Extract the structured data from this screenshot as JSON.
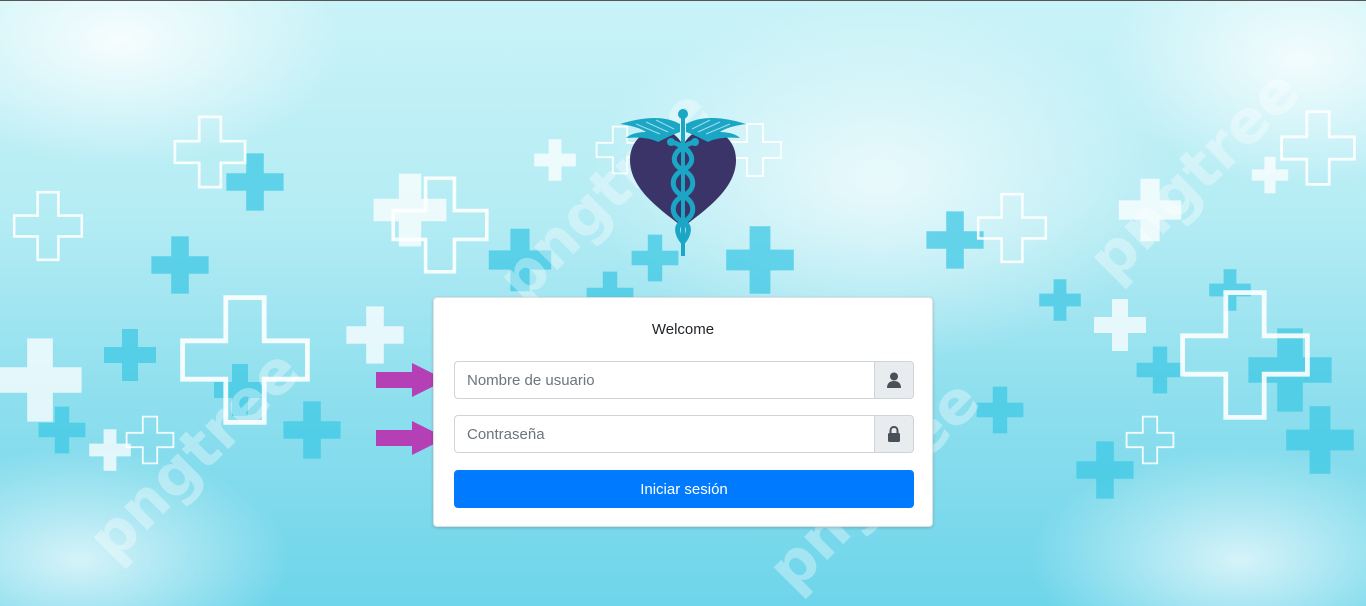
{
  "login": {
    "title": "Welcome",
    "username": {
      "placeholder": "Nombre de usuario",
      "value": "",
      "icon": "user-icon"
    },
    "password": {
      "placeholder": "Contraseña",
      "value": "",
      "icon": "lock-icon"
    },
    "submit_label": "Iniciar sesión"
  },
  "branding": {
    "logo": "caduceus-heart-logo",
    "watermark_text": "pngtree"
  },
  "annotations": {
    "arrow_color": "#b540b5",
    "items": [
      "arrow-right-icon",
      "arrow-right-icon"
    ]
  },
  "colors": {
    "primary_button": "#007bff",
    "logo_heart": "#3b3468",
    "logo_caduceus": "#1aa6c4",
    "background_top": "#c9f3f8",
    "background_bottom": "#6ed5ea"
  }
}
